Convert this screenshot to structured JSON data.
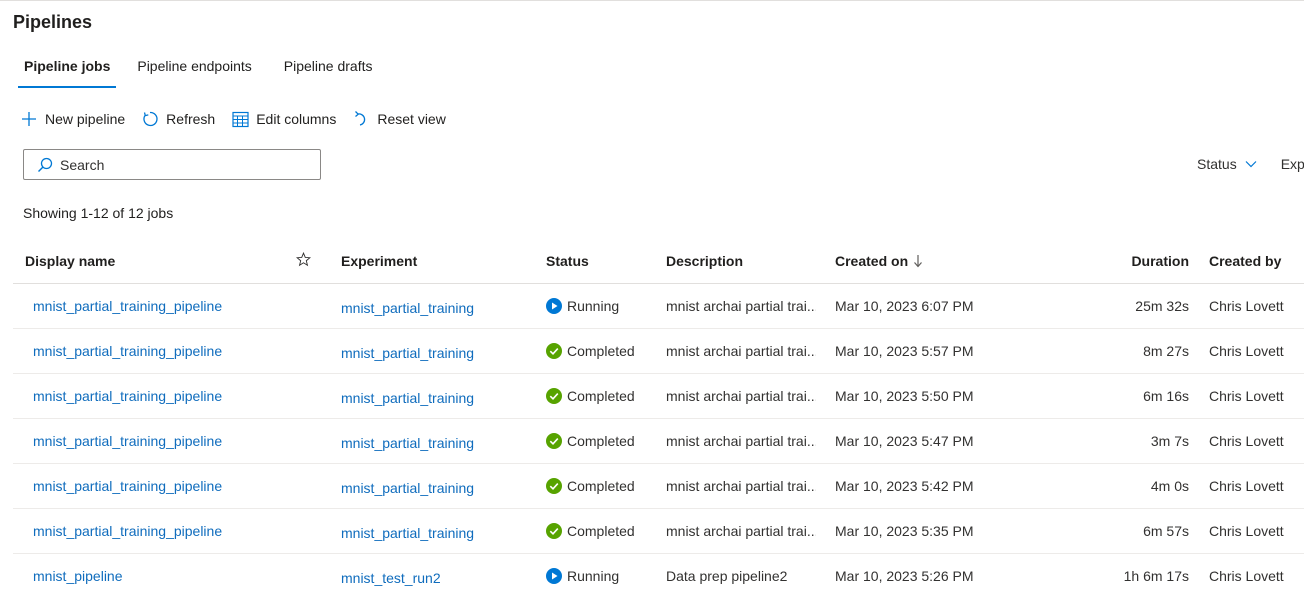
{
  "page": {
    "title": "Pipelines"
  },
  "tabs": [
    {
      "label": "Pipeline jobs",
      "active": true
    },
    {
      "label": "Pipeline endpoints",
      "active": false
    },
    {
      "label": "Pipeline drafts",
      "active": false
    }
  ],
  "toolbar": {
    "new_pipeline": "New pipeline",
    "refresh": "Refresh",
    "edit_columns": "Edit columns",
    "reset_view": "Reset view"
  },
  "search": {
    "placeholder": "Search",
    "value": ""
  },
  "filters": {
    "status": "Status",
    "experiment": "Expe"
  },
  "showing": "Showing 1-12 of 12 jobs",
  "columns": {
    "display_name": "Display name",
    "experiment": "Experiment",
    "status": "Status",
    "description": "Description",
    "created_on": "Created on",
    "duration": "Duration",
    "created_by": "Created by"
  },
  "rows": [
    {
      "display_name": "mnist_partial_training_pipeline",
      "experiment": "mnist_partial_training",
      "status": "Running",
      "description": "mnist archai partial trai...",
      "created_on": "Mar 10, 2023 6:07 PM",
      "duration": "25m 32s",
      "created_by": "Chris Lovett"
    },
    {
      "display_name": "mnist_partial_training_pipeline",
      "experiment": "mnist_partial_training",
      "status": "Completed",
      "description": "mnist archai partial trai...",
      "created_on": "Mar 10, 2023 5:57 PM",
      "duration": "8m 27s",
      "created_by": "Chris Lovett"
    },
    {
      "display_name": "mnist_partial_training_pipeline",
      "experiment": "mnist_partial_training",
      "status": "Completed",
      "description": "mnist archai partial trai...",
      "created_on": "Mar 10, 2023 5:50 PM",
      "duration": "6m 16s",
      "created_by": "Chris Lovett"
    },
    {
      "display_name": "mnist_partial_training_pipeline",
      "experiment": "mnist_partial_training",
      "status": "Completed",
      "description": "mnist archai partial trai...",
      "created_on": "Mar 10, 2023 5:47 PM",
      "duration": "3m 7s",
      "created_by": "Chris Lovett"
    },
    {
      "display_name": "mnist_partial_training_pipeline",
      "experiment": "mnist_partial_training",
      "status": "Completed",
      "description": "mnist archai partial trai...",
      "created_on": "Mar 10, 2023 5:42 PM",
      "duration": "4m 0s",
      "created_by": "Chris Lovett"
    },
    {
      "display_name": "mnist_partial_training_pipeline",
      "experiment": "mnist_partial_training",
      "status": "Completed",
      "description": "mnist archai partial trai...",
      "created_on": "Mar 10, 2023 5:35 PM",
      "duration": "6m 57s",
      "created_by": "Chris Lovett"
    },
    {
      "display_name": "mnist_pipeline",
      "experiment": "mnist_test_run2",
      "status": "Running",
      "description": "Data prep pipeline2",
      "created_on": "Mar 10, 2023 5:26 PM",
      "duration": "1h 6m 17s",
      "created_by": "Chris Lovett"
    }
  ],
  "colors": {
    "accent": "#0078d4",
    "link": "#0f6cbd",
    "running": "#0078d4",
    "completed": "#57a300"
  },
  "icons": {
    "new": "plus-icon",
    "refresh": "refresh-icon",
    "edit_columns": "table-grid-icon",
    "reset": "undo-icon",
    "search": "search-icon",
    "favorite": "star-icon",
    "sort": "arrow-down-icon",
    "running": "play-circle-icon",
    "completed": "check-circle-icon"
  }
}
